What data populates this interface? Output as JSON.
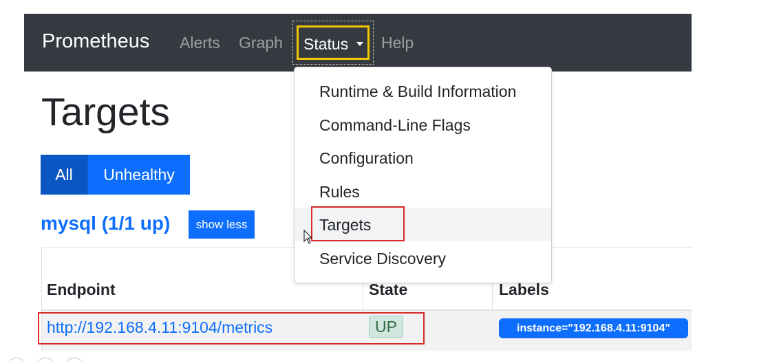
{
  "navbar": {
    "brand": "Prometheus",
    "links": [
      "Alerts",
      "Graph",
      "Help"
    ],
    "status_label": "Status"
  },
  "page": {
    "title": "Targets",
    "filter_buttons": [
      "All",
      "Unhealthy"
    ],
    "job_title": "mysql (1/1 up)",
    "show_less_label": "show less"
  },
  "table": {
    "headers": [
      "Endpoint",
      "State",
      "Labels"
    ],
    "rows": [
      {
        "endpoint": "http://192.168.4.11:9104/metrics",
        "state": "UP",
        "label": "instance=\"192.168.4.11:9104\""
      }
    ]
  },
  "status_menu": {
    "items": [
      "Runtime & Build Information",
      "Command-Line Flags",
      "Configuration",
      "Rules",
      "Targets",
      "Service Discovery"
    ]
  },
  "colors": {
    "navbar": "#343a40",
    "primary": "#0d6efd",
    "highlight_red": "#d62828",
    "focus_yellow": "#f2c700",
    "up_badge": "#d1e7dd"
  }
}
